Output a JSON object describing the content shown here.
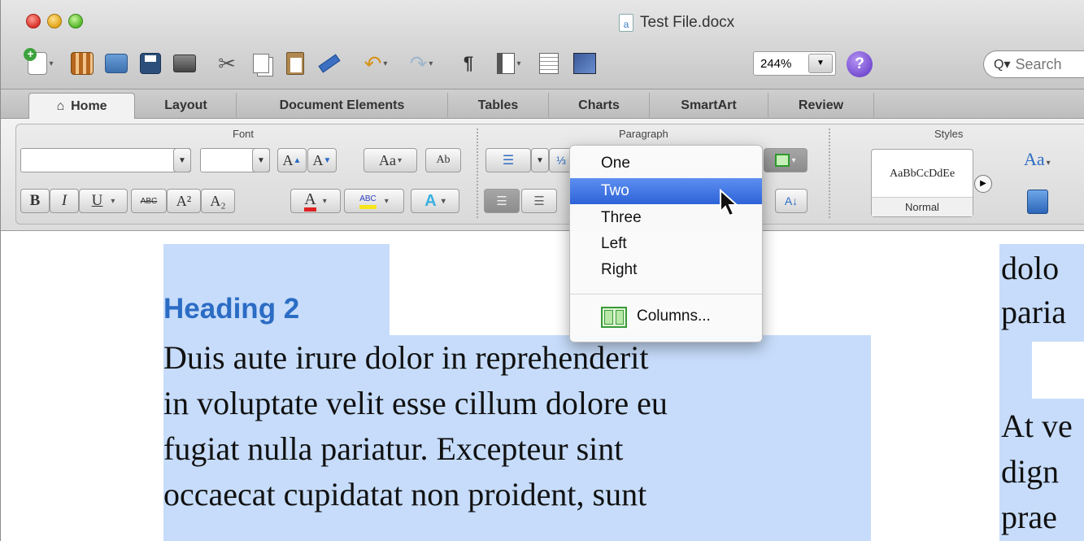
{
  "window": {
    "title": "Test File.docx",
    "doc_icon_letter": "a"
  },
  "toolbar": {
    "zoom": "244%",
    "help": "?",
    "search_placeholder": "Search"
  },
  "tabs": [
    "Home",
    "Layout",
    "Document Elements",
    "Tables",
    "Charts",
    "SmartArt",
    "Review"
  ],
  "ribbon": {
    "groups": {
      "font": "Font",
      "paragraph": "Paragraph",
      "styles": "Styles"
    },
    "font_buttons": {
      "bold": "B",
      "italic": "I",
      "underline": "U",
      "strike": "ABC",
      "grow": "A",
      "shrink": "A",
      "change_case": "Aa",
      "clear": "Ab"
    },
    "style_sample": "AaBbCcDdEe",
    "style_name": "Normal"
  },
  "menu": {
    "items": [
      "One",
      "Two",
      "Three",
      "Left",
      "Right"
    ],
    "highlighted": "Two",
    "more": "Columns..."
  },
  "document": {
    "heading": "Heading 2",
    "left_lines": [
      "Duis aute irure dolor in reprehenderit",
      "in voluptate velit esse cillum dolore eu",
      "fugiat nulla pariatur. Excepteur sint",
      "occaecat cupidatat non proident, sunt"
    ],
    "right_lines": [
      "dolo",
      "paria",
      "At ve",
      "dign",
      "prae"
    ]
  },
  "colors": {
    "selection": "#c6dcfa",
    "heading": "#2b6cc4",
    "menu_highlight": "#3a6fe0"
  }
}
